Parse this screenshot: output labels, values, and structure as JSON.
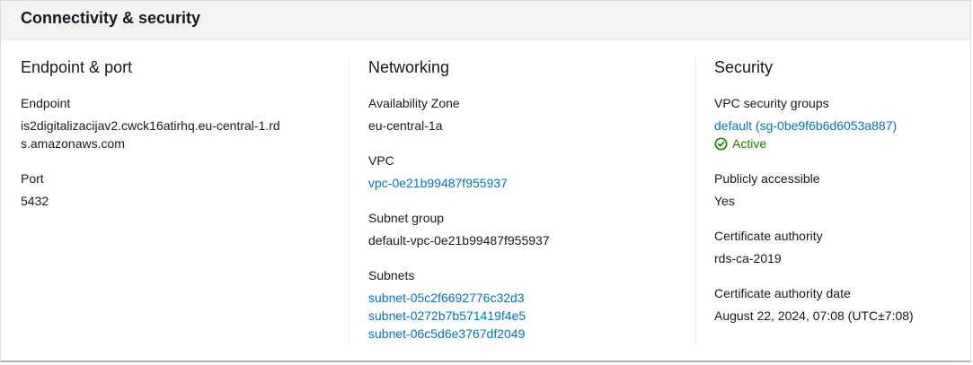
{
  "panel": {
    "title": "Connectivity & security"
  },
  "endpoint_port": {
    "heading": "Endpoint & port",
    "endpoint_label": "Endpoint",
    "endpoint_value": "is2digitalizacijav2.cwck16atirhq.eu-central-1.rds.amazonaws.com",
    "port_label": "Port",
    "port_value": "5432"
  },
  "networking": {
    "heading": "Networking",
    "az_label": "Availability Zone",
    "az_value": "eu-central-1a",
    "vpc_label": "VPC",
    "vpc_value": "vpc-0e21b99487f955937",
    "subnet_group_label": "Subnet group",
    "subnet_group_value": "default-vpc-0e21b99487f955937",
    "subnets_label": "Subnets",
    "subnets": [
      "subnet-05c2f6692776c32d3",
      "subnet-0272b7b571419f4e5",
      "subnet-06c5d6e3767df2049"
    ]
  },
  "security": {
    "heading": "Security",
    "vpc_sg_label": "VPC security groups",
    "vpc_sg_value": "default (sg-0be9f6b6d6053a887)",
    "vpc_sg_status": "Active",
    "public_label": "Publicly accessible",
    "public_value": "Yes",
    "ca_label": "Certificate authority",
    "ca_value": "rds-ca-2019",
    "ca_date_label": "Certificate authority date",
    "ca_date_value": "August 22, 2024, 07:08 (UTC±7:08)"
  },
  "colors": {
    "link": "#0073bb",
    "success": "#1d8102",
    "header_bg": "#f2f3f3"
  },
  "icons": {
    "status": "check-circle-icon"
  }
}
